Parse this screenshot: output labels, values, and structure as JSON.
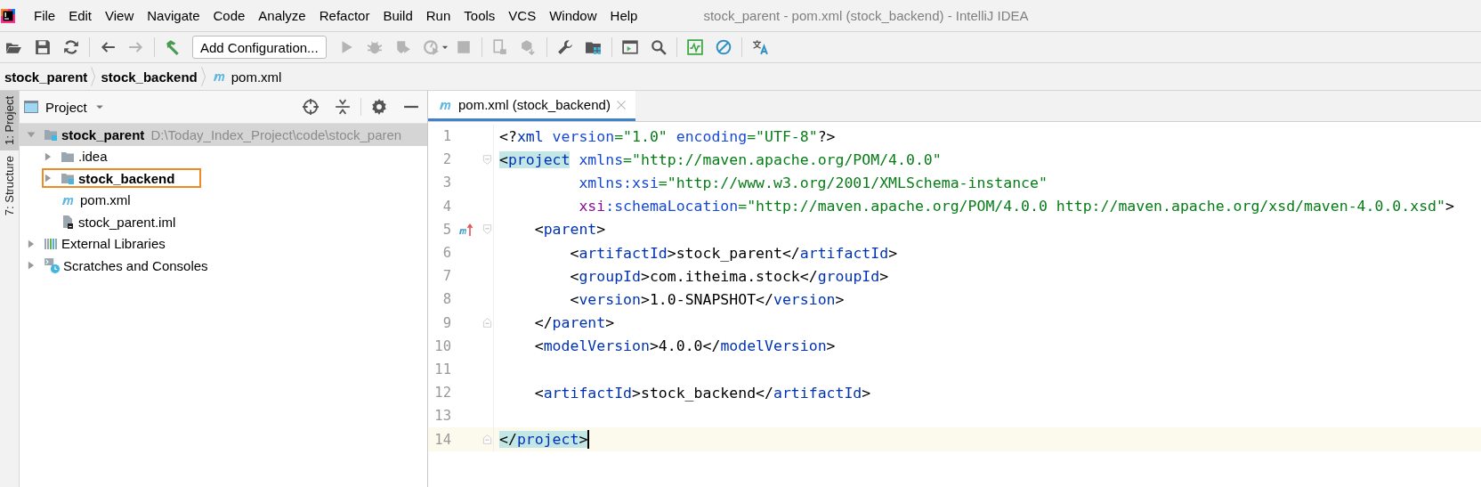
{
  "menu": {
    "items": [
      {
        "label": "File"
      },
      {
        "label": "Edit"
      },
      {
        "label": "View"
      },
      {
        "label": "Navigate"
      },
      {
        "label": "Code"
      },
      {
        "label": "Analyze"
      },
      {
        "label": "Refactor"
      },
      {
        "label": "Build"
      },
      {
        "label": "Run"
      },
      {
        "label": "Tools"
      },
      {
        "label": "VCS"
      },
      {
        "label": "Window"
      },
      {
        "label": "Help"
      }
    ],
    "title": "stock_parent - pom.xml (stock_backend) - IntelliJ IDEA"
  },
  "toolbar": {
    "items": [
      {
        "kind": "button",
        "disabled": false
      },
      {
        "kind": "button",
        "disabled": false
      },
      {
        "kind": "button",
        "disabled": false
      },
      {
        "kind": "separator"
      },
      {
        "kind": "button",
        "disabled": false
      },
      {
        "kind": "button",
        "disabled": true
      },
      {
        "kind": "separator"
      },
      {
        "kind": "button",
        "disabled": false
      },
      {
        "kind": "config",
        "label": "Add Configuration..."
      },
      {
        "kind": "button",
        "disabled": true
      },
      {
        "kind": "button",
        "disabled": true
      },
      {
        "kind": "button",
        "disabled": true
      },
      {
        "kind": "button",
        "disabled": true
      },
      {
        "kind": "button",
        "disabled": true
      },
      {
        "kind": "separator"
      },
      {
        "kind": "button",
        "disabled": true
      },
      {
        "kind": "button",
        "disabled": true
      },
      {
        "kind": "separator"
      },
      {
        "kind": "button",
        "disabled": false
      },
      {
        "kind": "button",
        "disabled": false
      },
      {
        "kind": "separator"
      },
      {
        "kind": "button",
        "disabled": false
      },
      {
        "kind": "button",
        "disabled": false
      },
      {
        "kind": "separator"
      },
      {
        "kind": "button",
        "disabled": false
      },
      {
        "kind": "button",
        "disabled": false
      },
      {
        "kind": "separator"
      },
      {
        "kind": "button",
        "disabled": false
      }
    ]
  },
  "breadcrumbs": [
    {
      "label": "stock_parent",
      "kind": "module"
    },
    {
      "label": "stock_backend",
      "kind": "module"
    },
    {
      "label": "pom.xml",
      "kind": "maven"
    }
  ],
  "tool_strip": [
    {
      "label": "1: Project",
      "selected": true
    },
    {
      "label": "7: Structure",
      "selected": false
    }
  ],
  "project": {
    "title": "Project",
    "tree": [
      {
        "label": "stock_parent",
        "path": "D:\\Today_Index_Project\\code\\stock_paren",
        "kind": "module",
        "expanded": true,
        "selected": true,
        "outlined": false,
        "children": [
          {
            "label": ".idea",
            "kind": "folder",
            "expanded": false,
            "selected": false,
            "outlined": false
          },
          {
            "label": "stock_backend",
            "kind": "module",
            "expanded": false,
            "selected": false,
            "outlined": true
          },
          {
            "label": "pom.xml",
            "kind": "maven",
            "selected": false,
            "outlined": false
          },
          {
            "label": "stock_parent.iml",
            "kind": "iml",
            "selected": false,
            "outlined": false
          }
        ]
      },
      {
        "label": "External Libraries",
        "kind": "libraries",
        "expanded": false,
        "selected": false,
        "outlined": false
      },
      {
        "label": "Scratches and Consoles",
        "kind": "scratches",
        "expanded": false,
        "selected": false,
        "outlined": false
      }
    ]
  },
  "editor": {
    "tabs": [
      {
        "label": "pom.xml (stock_backend)",
        "selected": true
      }
    ],
    "lines": [
      {
        "number": "1",
        "current": false,
        "fold_open": false,
        "fold_close": false,
        "parent_marker": false,
        "tokens": [
          {
            "kind": "punct",
            "text": "<?",
            "highlighted": false
          },
          {
            "kind": "tag",
            "text": "xml",
            "highlighted": false
          },
          {
            "kind": "attr",
            "text": " version",
            "highlighted": false
          },
          {
            "kind": "value",
            "text": "=\"1.0\"",
            "highlighted": false
          },
          {
            "kind": "attr",
            "text": " encoding",
            "highlighted": false
          },
          {
            "kind": "value",
            "text": "=\"UTF-8\"",
            "highlighted": false
          },
          {
            "kind": "punct",
            "text": "?>",
            "highlighted": false
          }
        ]
      },
      {
        "number": "2",
        "current": false,
        "fold_open": true,
        "fold_close": false,
        "parent_marker": false,
        "tokens": [
          {
            "kind": "punct",
            "text": "<",
            "highlighted": true
          },
          {
            "kind": "tag",
            "text": "project",
            "highlighted": true
          },
          {
            "kind": "attr",
            "text": " xmlns",
            "highlighted": false
          },
          {
            "kind": "value",
            "text": "=\"http://maven.apache.org/POM/4.0.0\"",
            "highlighted": false
          }
        ]
      },
      {
        "number": "3",
        "current": false,
        "fold_open": false,
        "fold_close": false,
        "parent_marker": false,
        "tokens": [
          {
            "kind": "attr",
            "text": "         xmlns:xsi",
            "highlighted": false
          },
          {
            "kind": "value",
            "text": "=\"http://www.w3.org/2001/XMLSchema-instance\"",
            "highlighted": false
          }
        ]
      },
      {
        "number": "4",
        "current": false,
        "fold_open": false,
        "fold_close": false,
        "parent_marker": false,
        "tokens": [
          {
            "kind": "prefix",
            "text": "         xsi",
            "highlighted": false
          },
          {
            "kind": "attr",
            "text": ":schemaLocation",
            "highlighted": false
          },
          {
            "kind": "value",
            "text": "=\"http://maven.apache.org/POM/4.0.0 http://maven.apache.org/xsd/maven-4.0.0.xsd\"",
            "highlighted": false
          },
          {
            "kind": "punct",
            "text": ">",
            "highlighted": false
          }
        ]
      },
      {
        "number": "5",
        "current": false,
        "fold_open": true,
        "fold_close": false,
        "parent_marker": true,
        "tokens": [
          {
            "kind": "punct",
            "text": "    <",
            "highlighted": false
          },
          {
            "kind": "tag",
            "text": "parent",
            "highlighted": false
          },
          {
            "kind": "punct",
            "text": ">",
            "highlighted": false
          }
        ]
      },
      {
        "number": "6",
        "current": false,
        "fold_open": false,
        "fold_close": false,
        "parent_marker": false,
        "tokens": [
          {
            "kind": "punct",
            "text": "        <",
            "highlighted": false
          },
          {
            "kind": "tag",
            "text": "artifactId",
            "highlighted": false
          },
          {
            "kind": "punct",
            "text": ">",
            "highlighted": false
          },
          {
            "kind": "text",
            "text": "stock_parent",
            "highlighted": false
          },
          {
            "kind": "punct",
            "text": "</",
            "highlighted": false
          },
          {
            "kind": "tag",
            "text": "artifactId",
            "highlighted": false
          },
          {
            "kind": "punct",
            "text": ">",
            "highlighted": false
          }
        ]
      },
      {
        "number": "7",
        "current": false,
        "fold_open": false,
        "fold_close": false,
        "parent_marker": false,
        "tokens": [
          {
            "kind": "punct",
            "text": "        <",
            "highlighted": false
          },
          {
            "kind": "tag",
            "text": "groupId",
            "highlighted": false
          },
          {
            "kind": "punct",
            "text": ">",
            "highlighted": false
          },
          {
            "kind": "text",
            "text": "com.itheima.stock",
            "highlighted": false
          },
          {
            "kind": "punct",
            "text": "</",
            "highlighted": false
          },
          {
            "kind": "tag",
            "text": "groupId",
            "highlighted": false
          },
          {
            "kind": "punct",
            "text": ">",
            "highlighted": false
          }
        ]
      },
      {
        "number": "8",
        "current": false,
        "fold_open": false,
        "fold_close": false,
        "parent_marker": false,
        "tokens": [
          {
            "kind": "punct",
            "text": "        <",
            "highlighted": false
          },
          {
            "kind": "tag",
            "text": "version",
            "highlighted": false
          },
          {
            "kind": "punct",
            "text": ">",
            "highlighted": false
          },
          {
            "kind": "text",
            "text": "1.0-SNAPSHOT",
            "highlighted": false
          },
          {
            "kind": "punct",
            "text": "</",
            "highlighted": false
          },
          {
            "kind": "tag",
            "text": "version",
            "highlighted": false
          },
          {
            "kind": "punct",
            "text": ">",
            "highlighted": false
          }
        ]
      },
      {
        "number": "9",
        "current": false,
        "fold_open": false,
        "fold_close": true,
        "parent_marker": false,
        "tokens": [
          {
            "kind": "punct",
            "text": "    </",
            "highlighted": false
          },
          {
            "kind": "tag",
            "text": "parent",
            "highlighted": false
          },
          {
            "kind": "punct",
            "text": ">",
            "highlighted": false
          }
        ]
      },
      {
        "number": "10",
        "current": false,
        "fold_open": false,
        "fold_close": false,
        "parent_marker": false,
        "tokens": [
          {
            "kind": "punct",
            "text": "    <",
            "highlighted": false
          },
          {
            "kind": "tag",
            "text": "modelVersion",
            "highlighted": false
          },
          {
            "kind": "punct",
            "text": ">",
            "highlighted": false
          },
          {
            "kind": "text",
            "text": "4.0.0",
            "highlighted": false
          },
          {
            "kind": "punct",
            "text": "</",
            "highlighted": false
          },
          {
            "kind": "tag",
            "text": "modelVersion",
            "highlighted": false
          },
          {
            "kind": "punct",
            "text": ">",
            "highlighted": false
          }
        ]
      },
      {
        "number": "11",
        "current": false,
        "fold_open": false,
        "fold_close": false,
        "parent_marker": false
      },
      {
        "number": "12",
        "current": false,
        "fold_open": false,
        "fold_close": false,
        "parent_marker": false,
        "tokens": [
          {
            "kind": "punct",
            "text": "    <",
            "highlighted": false
          },
          {
            "kind": "tag",
            "text": "artifactId",
            "highlighted": false
          },
          {
            "kind": "punct",
            "text": ">",
            "highlighted": false
          },
          {
            "kind": "text",
            "text": "stock_backend",
            "highlighted": false
          },
          {
            "kind": "punct",
            "text": "</",
            "highlighted": false
          },
          {
            "kind": "tag",
            "text": "artifactId",
            "highlighted": false
          },
          {
            "kind": "punct",
            "text": ">",
            "highlighted": false
          }
        ]
      },
      {
        "number": "13",
        "current": false,
        "fold_open": false,
        "fold_close": false,
        "parent_marker": false
      },
      {
        "number": "14",
        "current": true,
        "fold_open": false,
        "fold_close": true,
        "parent_marker": false,
        "tokens": [
          {
            "kind": "punct",
            "text": "</",
            "highlighted": true
          },
          {
            "kind": "tag",
            "text": "project",
            "highlighted": true
          },
          {
            "kind": "punct",
            "text": ">",
            "highlighted": true
          }
        ]
      }
    ]
  }
}
